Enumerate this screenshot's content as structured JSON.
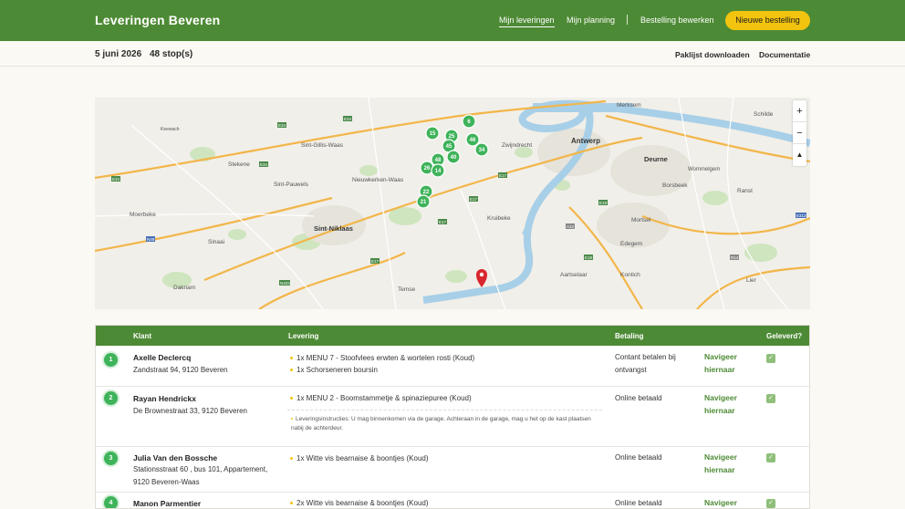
{
  "header": {
    "title": "Leveringen Beveren",
    "nav": [
      "Mijn leveringen",
      "Mijn planning",
      "Bestelling bewerken"
    ],
    "cta": "Nieuwe bestelling"
  },
  "subheader": {
    "date": "5 juni 2026",
    "stops": "48 stop(s)",
    "links": [
      "Paklijst downloaden",
      "Documentatie"
    ]
  },
  "map": {
    "places": [
      "Merksem",
      "Schilde",
      "Antwerp",
      "Zwijndrecht",
      "Sint-Gillis-Waas",
      "Keewach",
      "Stekene",
      "Deurne",
      "Wommelgem",
      "Sint-Pauwels",
      "Nieuwkerken-Waas",
      "Borsbeek",
      "Ranst",
      "Moerbeke",
      "Sint-Niklaas",
      "Kruibeke",
      "Mortsel",
      "Sinaai",
      "Edegem",
      "Aartselaar",
      "Kontich",
      "Lier",
      "Daknam",
      "Temse"
    ],
    "roads": [
      "E34",
      "E34",
      "E34",
      "E34",
      "E17",
      "E17",
      "E17",
      "E17",
      "E19",
      "E19",
      "A12",
      "N49",
      "R14",
      "E313",
      "N403"
    ],
    "markers": [
      "15",
      "6",
      "25",
      "45",
      "46",
      "34",
      "40",
      "48",
      "26",
      "14",
      "22",
      "21"
    ],
    "zoom": [
      "+",
      "−",
      "▲"
    ],
    "accent_marker": "#3eb35a",
    "pin_color": "#d9262e"
  },
  "table": {
    "columns": [
      "Klant",
      "Levering",
      "Betaling",
      "Geleverd?"
    ],
    "rows": [
      {
        "num": "1",
        "name": "Axelle Declercq",
        "address": "Zandstraat 94, 9120 Beveren",
        "items": [
          "1x MENU 7 - Stoofvlees erwten & wortelen rosti (Koud)",
          "1x Schorseneren boursin"
        ],
        "note": "",
        "payment": "Contant betalen bij ontvangst",
        "navigate": "Navigeer hiernaar",
        "delivered": true
      },
      {
        "num": "2",
        "name": "Rayan Hendrickx",
        "address": "De Brownestraat 33, 9120 Beveren",
        "items": [
          "1x MENU 2 - Boomstammetje & spinaziepuree (Koud)"
        ],
        "note": "Leveringsinstructies: U mag binnenkomen via de garage. Achteraan in de garage, mag u het op de kast plaatsen nabij de achterdeur.",
        "payment": "Online betaald",
        "navigate": "Navigeer hiernaar",
        "delivered": true
      },
      {
        "num": "3",
        "name": "Julia Van den Bossche",
        "address": "Stationsstraat 60 , bus 101, Appartement, 9120 Beveren-Waas",
        "items": [
          "1x Witte vis bearnaise & boontjes (Koud)"
        ],
        "note": "",
        "payment": "Online betaald",
        "navigate": "Navigeer hiernaar",
        "delivered": true
      },
      {
        "num": "4",
        "name": "Manon Parmentier",
        "address": "",
        "items": [
          "2x Witte vis bearnaise & boontjes (Koud)"
        ],
        "note": "",
        "payment": "Online betaald",
        "navigate": "Navigeer",
        "delivered": true
      }
    ]
  },
  "colors": {
    "brand_green": "#4d8a35",
    "cta_yellow": "#f2c40f",
    "background": "#faf9f4"
  }
}
